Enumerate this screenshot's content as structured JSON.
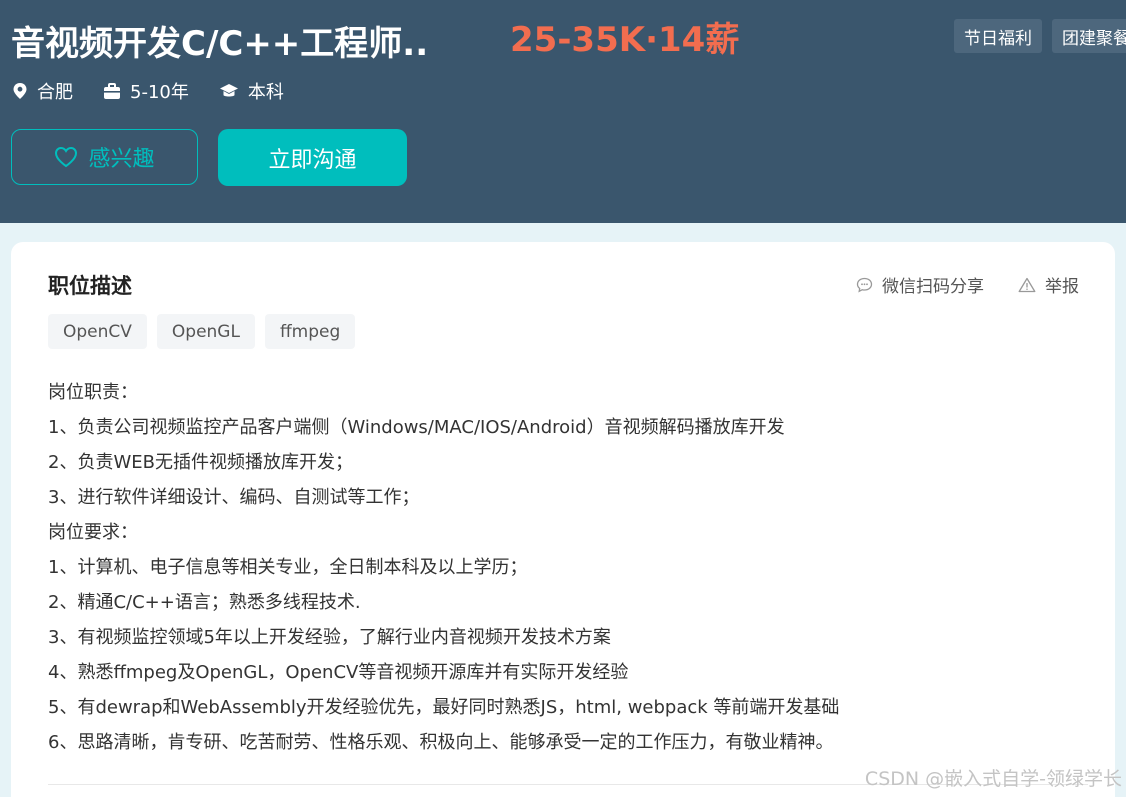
{
  "header": {
    "job_title": "音视频开发C/C++工程师...",
    "salary": "25-35K·14薪",
    "welfare_tags": [
      "节日福利",
      "团建聚餐"
    ],
    "location": "合肥",
    "experience": "5-10年",
    "education": "本科",
    "interest_button": "感兴趣",
    "chat_button": "立即沟通"
  },
  "card": {
    "section_title": "职位描述",
    "share_label": "微信扫码分享",
    "report_label": "举报",
    "skills": [
      "OpenCV",
      "OpenGL",
      "ffmpeg"
    ],
    "description": [
      "岗位职责：",
      "1、负责公司视频监控产品客户端侧（Windows/MAC/IOS/Android）音视频解码播放库开发",
      "2、负责WEB无插件视频播放库开发；",
      "3、进行软件详细设计、编码、自测试等工作；",
      "岗位要求：",
      "1、计算机、电子信息等相关专业，全日制本科及以上学历；",
      "2、精通C/C++语言；熟悉多线程技术.",
      "3、有视频监控领域5年以上开发经验，了解行业内音视频开发技术方案",
      "4、熟悉ffmpeg及OpenGL，OpenCV等音视频开源库并有实际开发经验",
      "5、有dewrap和WebAssembly开发经验优先，最好同时熟悉JS，html, webpack 等前端开发基础",
      "6、思路清晰，肯专研、吃苦耐劳、性格乐观、积极向上、能够承受一定的工作压力，有敬业精神。"
    ]
  },
  "watermark": "CSDN @嵌入式自学-领绿学长",
  "colors": {
    "header_bg": "#3a566d",
    "salary": "#f26d4f",
    "accent": "#00bebd",
    "page_bg": "#e6f3f7"
  }
}
